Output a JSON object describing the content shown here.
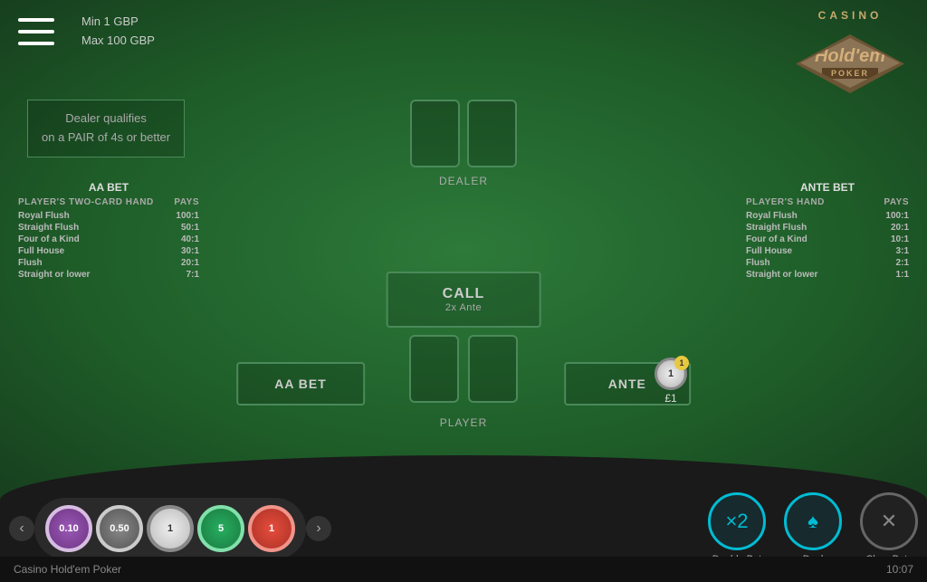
{
  "app": {
    "title": "Casino Hold'em Poker",
    "time": "10:07"
  },
  "limits": {
    "min": "Min 1 GBP",
    "max": "Max 100 GBP"
  },
  "logo": {
    "casino": "CASINO",
    "holdem": "Hold'em",
    "poker": "POKER"
  },
  "dealer_qualifier": {
    "line1": "Dealer qualifies",
    "line2": "on a PAIR of 4s or better"
  },
  "dealer_label": "DEALER",
  "player_label": "PLAYER",
  "call_button": {
    "label": "CALL",
    "sub": "2x Ante"
  },
  "paytable_left": {
    "title": "AA BET",
    "header_hand": "PLAYER'S TWO-CARD HAND",
    "header_pays": "PAYS",
    "rows": [
      {
        "hand": "Royal Flush",
        "pays": "100:1"
      },
      {
        "hand": "Straight Flush",
        "pays": "50:1"
      },
      {
        "hand": "Four of a Kind",
        "pays": "40:1"
      },
      {
        "hand": "Full House",
        "pays": "30:1"
      },
      {
        "hand": "Flush",
        "pays": "20:1"
      },
      {
        "hand": "Straight or lower",
        "pays": "7:1"
      }
    ]
  },
  "paytable_right": {
    "title": "ANTE BET",
    "header_hand": "PLAYER'S HAND",
    "header_pays": "PAYS",
    "rows": [
      {
        "hand": "Royal Flush",
        "pays": "100:1"
      },
      {
        "hand": "Straight Flush",
        "pays": "20:1"
      },
      {
        "hand": "Four of a Kind",
        "pays": "10:1"
      },
      {
        "hand": "Full House",
        "pays": "3:1"
      },
      {
        "hand": "Flush",
        "pays": "2:1"
      },
      {
        "hand": "Straight or lower",
        "pays": "1:1"
      }
    ]
  },
  "bet_buttons": {
    "aa_bet": "AA BET",
    "ante": "ANTE"
  },
  "ante_chip": {
    "badge": "1",
    "amount": "£1"
  },
  "chips": [
    {
      "label": "0.10",
      "class": "chip-purple"
    },
    {
      "label": "0.50",
      "class": "chip-gray"
    },
    {
      "label": "1",
      "class": "chip-white"
    },
    {
      "label": "5",
      "class": "chip-green"
    },
    {
      "label": "1",
      "class": "chip-red"
    }
  ],
  "actions": [
    {
      "label": "Double Bet",
      "icon": "×2",
      "type": "teal"
    },
    {
      "label": "Deal",
      "icon": "♠",
      "type": "teal"
    },
    {
      "label": "Clear Bets",
      "icon": "✕",
      "type": "gray"
    }
  ]
}
